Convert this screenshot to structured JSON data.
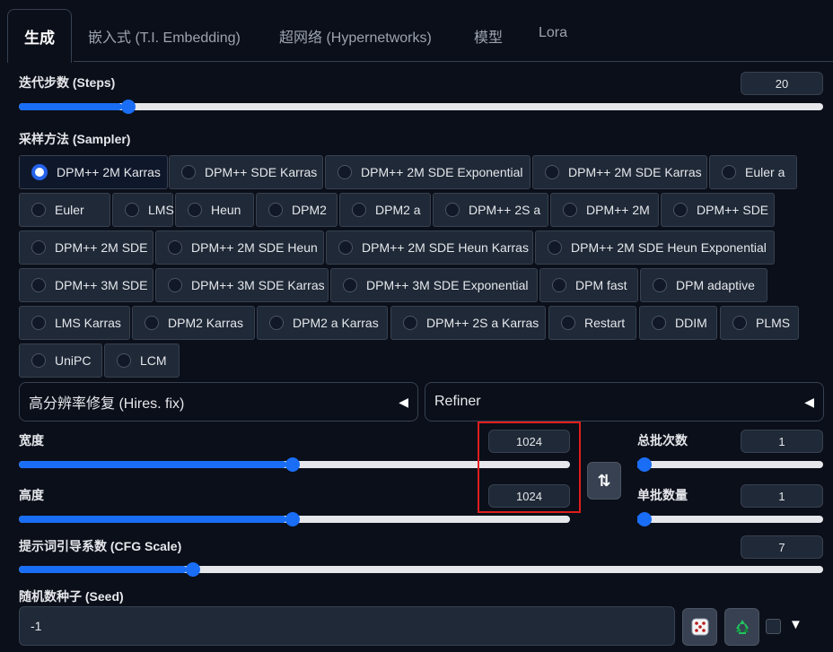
{
  "tabs": [
    {
      "label": "生成"
    },
    {
      "label": "嵌入式 (T.I. Embedding)"
    },
    {
      "label": "超网络 (Hypernetworks)"
    },
    {
      "label": "模型"
    },
    {
      "label": "Lora"
    }
  ],
  "steps": {
    "label": "迭代步数 (Steps)",
    "value": "20",
    "fraction": 0.127
  },
  "sampler": {
    "label": "采样方法 (Sampler)",
    "selected": "DPM++ 2M Karras",
    "options": [
      "DPM++ 2M Karras",
      "DPM++ SDE Karras",
      "DPM++ 2M SDE Exponential",
      "DPM++ 2M SDE Karras",
      "Euler a",
      "Euler",
      "LMS",
      "Heun",
      "DPM2",
      "DPM2 a",
      "DPM++ 2S a",
      "DPM++ 2M",
      "DPM++ SDE",
      "DPM++ 2M SDE",
      "DPM++ 2M SDE Heun",
      "DPM++ 2M SDE Heun Karras",
      "DPM++ 2M SDE Heun Exponential",
      "DPM++ 3M SDE",
      "DPM++ 3M SDE Karras",
      "DPM++ 3M SDE Exponential",
      "DPM fast",
      "DPM adaptive",
      "LMS Karras",
      "DPM2 Karras",
      "DPM2 a Karras",
      "DPM++ 2S a Karras",
      "Restart",
      "DDIM",
      "PLMS",
      "UniPC",
      "LCM"
    ]
  },
  "hires_fix": {
    "label": "高分辨率修复 (Hires. fix)",
    "arrow": "◀"
  },
  "refiner": {
    "label": "Refiner",
    "arrow": "◀"
  },
  "width": {
    "label": "宽度",
    "value": "1024",
    "fraction": 0.486
  },
  "height": {
    "label": "高度",
    "value": "1024",
    "fraction": 0.486
  },
  "swap_button": {
    "icon": "swap-arrows-icon",
    "glyph": "⇅"
  },
  "batch_count": {
    "label": "总批次数",
    "value": "1",
    "fraction": 0.0
  },
  "batch_size": {
    "label": "单批数量",
    "value": "1",
    "fraction": 0.0
  },
  "cfg_scale": {
    "label": "提示词引导系数 (CFG Scale)",
    "value": "7",
    "fraction": 0.208
  },
  "seed": {
    "label": "随机数种子 (Seed)",
    "value": "-1",
    "random_icon": "dice-icon",
    "reuse_icon": "recycle-icon",
    "extra_arrow": "▼"
  },
  "colors": {
    "accent": "#1a6ef5",
    "highlight": "#e11d1d",
    "background": "#0b0f19",
    "panel": "#1f2937"
  }
}
